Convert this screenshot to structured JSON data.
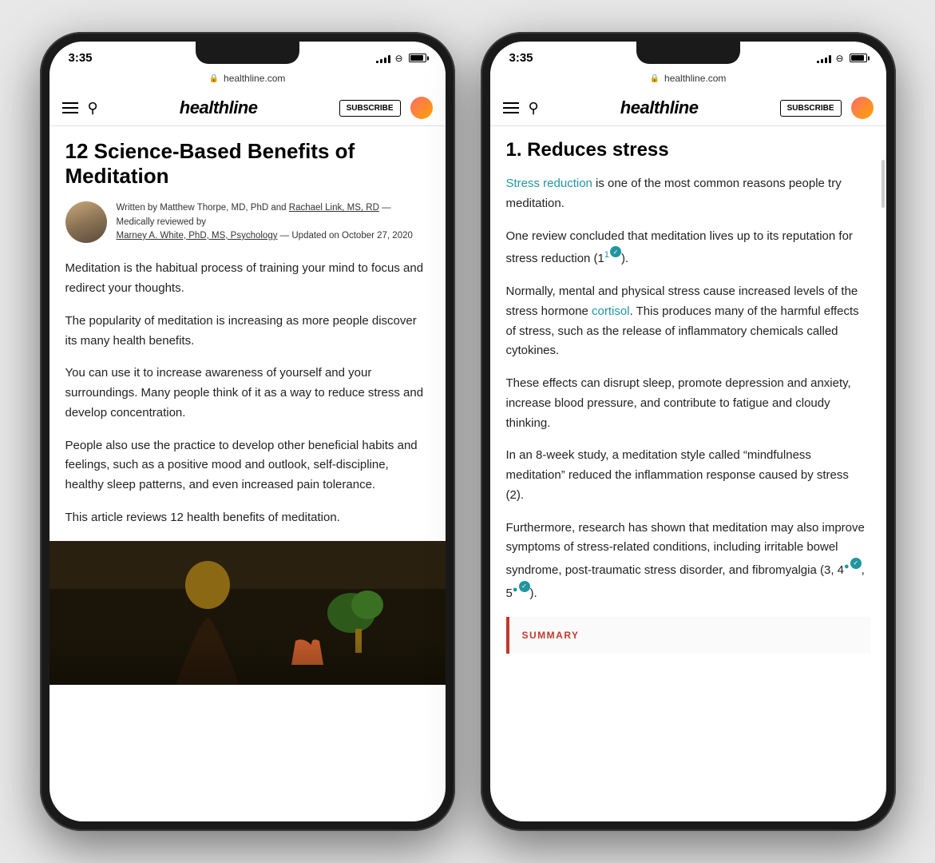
{
  "phone1": {
    "status": {
      "time": "3:35",
      "url": "healthline.com",
      "lock": "🔒",
      "subscribe": "SUBSCRIBE"
    },
    "article": {
      "title": "12 Science-Based Benefits of Meditation",
      "author_line1": "Written by Matthew Thorpe, MD, PhD and",
      "author_line2": "Rachael Link, MS, RD",
      "author_line3": " — Medically reviewed by",
      "author_link": "Marney A. White, PhD, MS, Psychology",
      "author_date": " — Updated on October 27, 2020",
      "para1": "Meditation is the habitual process of training your mind to focus and redirect your thoughts.",
      "para2": "The popularity of meditation is increasing as more people discover its many health benefits.",
      "para3": "You can use it to increase awareness of yourself and your surroundings. Many people think of it as a way to reduce stress and develop concentration.",
      "para4": "People also use the practice to develop other beneficial habits and feelings, such as a positive mood and outlook, self-discipline, healthy sleep patterns, and even increased pain tolerance.",
      "para5": "This article reviews 12 health benefits of meditation."
    }
  },
  "phone2": {
    "status": {
      "time": "3:35",
      "url": "healthline.com",
      "lock": "🔒",
      "subscribe": "SUBSCRIBE"
    },
    "article": {
      "section_heading": "1. Reduces stress",
      "para1_link": "Stress reduction",
      "para1_rest": " is one of the most common reasons people try meditation.",
      "para2": "One review concluded that meditation lives up to its reputation for stress reduction (1",
      "para2_end": ").",
      "para3": "Normally, mental and physical stress cause increased levels of the stress hormone ",
      "para3_link": "cortisol",
      "para3_rest": ". This produces many of the harmful effects of stress, such as the release of inflammatory chemicals called cytokines.",
      "para4": "These effects can disrupt sleep, promote depression and anxiety, increase blood pressure, and contribute to fatigue and cloudy thinking.",
      "para5": "In an 8-week study, a meditation style called “mindfulness meditation” reduced the inflammation response caused by stress (2).",
      "para6": "Furthermore, research has shown that meditation may also improve symptoms of stress-related conditions, including irritable bowel syndrome, post-traumatic stress disorder, and fibromyalgia (3, 4",
      "para6_mid": ", 5",
      "para6_end": ").",
      "summary_label": "SUMMARY"
    }
  },
  "icons": {
    "hamburger": "☰",
    "search": "🔍",
    "logo": "healthline"
  }
}
